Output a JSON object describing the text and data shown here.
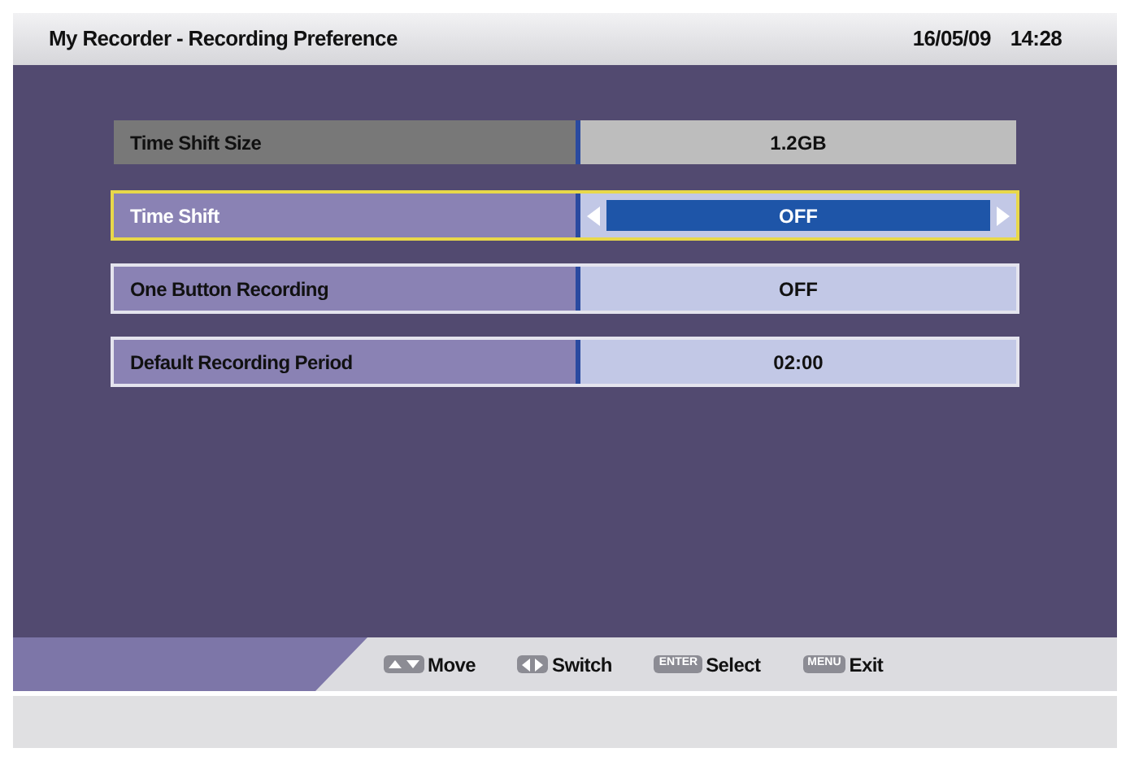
{
  "header": {
    "title": "My Recorder - Recording Preference",
    "date": "16/05/09",
    "time": "14:28"
  },
  "settings": [
    {
      "label": "Time Shift Size",
      "value": "1.2GB",
      "disabled": true,
      "selected": false
    },
    {
      "label": "Time Shift",
      "value": "OFF",
      "disabled": false,
      "selected": true
    },
    {
      "label": "One Button Recording",
      "value": "OFF",
      "disabled": false,
      "selected": false
    },
    {
      "label": "Default Recording Period",
      "value": "02:00",
      "disabled": false,
      "selected": false
    }
  ],
  "hints": [
    {
      "key": {
        "kind": "updown"
      },
      "label": "Move"
    },
    {
      "key": {
        "kind": "leftright"
      },
      "label": "Switch"
    },
    {
      "key": {
        "kind": "text",
        "text": "ENTER"
      },
      "label": "Select"
    },
    {
      "key": {
        "kind": "text",
        "text": "MENU"
      },
      "label": "Exit"
    }
  ]
}
